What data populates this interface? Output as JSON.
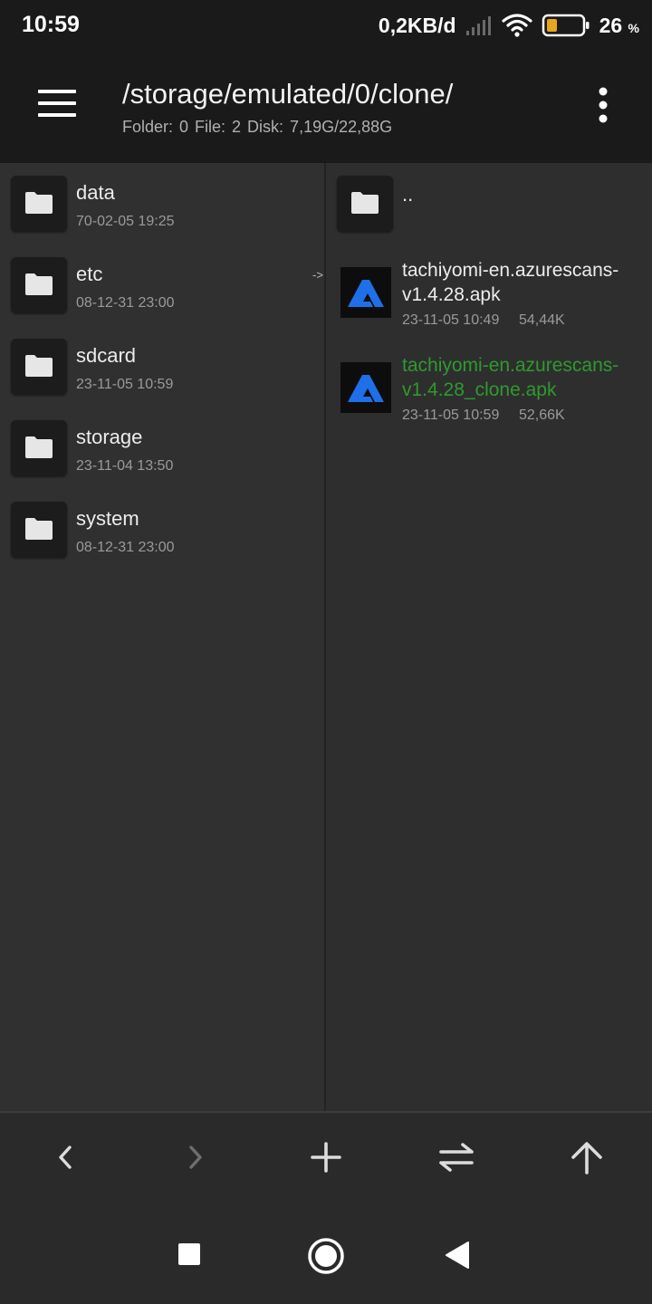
{
  "status_bar": {
    "time": "10:59",
    "net_speed": "0,2KB/d",
    "battery_percent": "26",
    "battery_unit": "%",
    "icons": [
      "signal-icon",
      "wifi-icon",
      "battery-icon"
    ]
  },
  "header": {
    "path": "/storage/emulated/0/clone/",
    "info": "Folder: 0  File: 2  Disk: 7,19G/22,88G",
    "menu_icon": "hamburger-menu-icon",
    "more_icon": "more-vert-icon"
  },
  "left_pane": {
    "items": [
      {
        "name": "data",
        "date": "70-02-05 19:25",
        "icon": "folder-icon"
      },
      {
        "name": "etc",
        "date": "08-12-31 23:00",
        "icon": "folder-icon"
      },
      {
        "name": "sdcard",
        "date": "23-11-05 10:59",
        "icon": "folder-icon"
      },
      {
        "name": "storage",
        "date": "23-11-04 13:50",
        "icon": "folder-icon"
      },
      {
        "name": "system",
        "date": "08-12-31 23:00",
        "icon": "folder-icon"
      }
    ],
    "link_marker": "->"
  },
  "right_pane": {
    "parent": {
      "name": "..",
      "icon": "folder-icon"
    },
    "files": [
      {
        "name_line1": "tachiyomi-en.azurescans-",
        "name_line2": "v1.4.28.apk",
        "date": "23-11-05 10:49",
        "size": "54,44K",
        "icon": "azurescans-app-icon"
      },
      {
        "name_line1": "tachiyomi-en.azurescans-",
        "name_line2": "v1.4.28_clone.apk",
        "date": "23-11-05 10:59",
        "size": "52,66K",
        "icon": "azurescans-app-icon",
        "highlight_color": "#2e9a2e"
      }
    ]
  },
  "toolbar": {
    "buttons": [
      "back-icon",
      "forward-icon",
      "add-icon",
      "swap-icon",
      "up-icon"
    ]
  },
  "navbar": {
    "buttons": [
      "recents-icon",
      "home-icon",
      "nav-back-icon"
    ]
  },
  "colors": {
    "header_bg": "#1a1a1a",
    "pane_bg": "#303030",
    "accent_green": "#2e9a2e",
    "apk_icon_blue": "#1e6fe8"
  }
}
